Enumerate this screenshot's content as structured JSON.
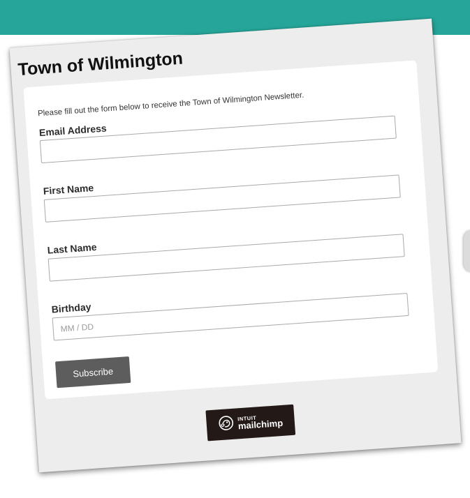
{
  "form": {
    "title": "Town of Wilmington",
    "intro": "Please fill out the form below to receive the Town of Wilmington Newsletter.",
    "fields": [
      {
        "label": "Email Address",
        "value": "",
        "placeholder": ""
      },
      {
        "label": "First Name",
        "value": "",
        "placeholder": ""
      },
      {
        "label": "Last Name",
        "value": "",
        "placeholder": ""
      },
      {
        "label": "Birthday",
        "value": "",
        "placeholder": "MM / DD"
      }
    ],
    "subscribe_label": "Subscribe"
  },
  "badge": {
    "line1": "INTUIT",
    "line2": "mailchimp",
    "icon": "mailchimp-freddie-icon"
  },
  "colors": {
    "header_bar": "#26a69a",
    "button": "#5d5d5d",
    "badge": "#231a17",
    "card": "#ededed"
  }
}
